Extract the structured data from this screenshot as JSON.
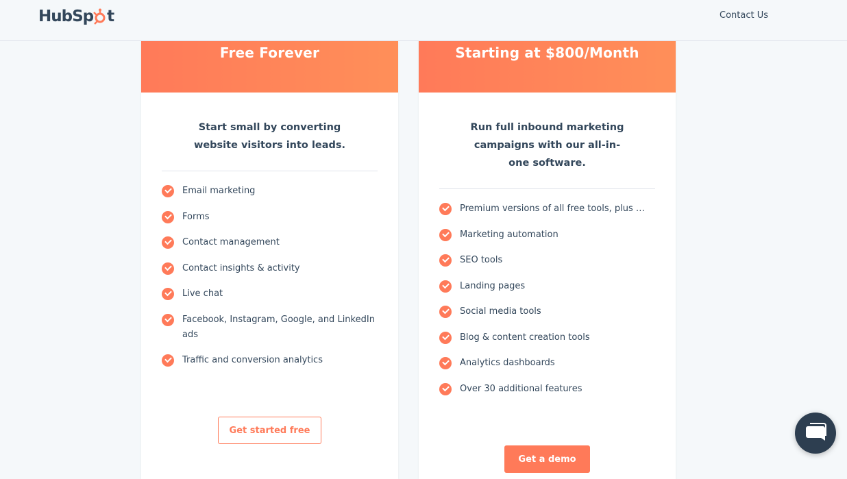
{
  "header": {
    "logo_text": "HubSpot",
    "contact_label": "Contact Us"
  },
  "plans": [
    {
      "price_label": "Free Forever",
      "description": "Start small by converting website visitors into leads.",
      "features": [
        "Email marketing",
        "Forms",
        "Contact management",
        "Contact insights & activity",
        "Live chat",
        "Facebook, Instagram, Google, and LinkedIn ads",
        "Traffic and conversion analytics"
      ],
      "cta_label": "Get started free"
    },
    {
      "price_label": "Starting at $800/Month",
      "description": "Run full inbound marketing campaigns with our all-in-one software.",
      "features": [
        "Premium versions of all free tools, plus …",
        "Marketing automation",
        "SEO tools",
        "Landing pages",
        "Social media tools",
        "Blog & content creation tools",
        "Analytics dashboards",
        "Over 30 additional features"
      ],
      "cta_label": "Get a demo"
    }
  ],
  "icons": {
    "feature_check": "check-circle-icon",
    "chat": "chat-bubble-icon",
    "logo_sprocket": "hubspot-sprocket-icon"
  },
  "colors": {
    "accent": "#ff7a59",
    "text": "#33475b",
    "background": "#f5f8fa",
    "chat_button": "#2d3e50"
  }
}
